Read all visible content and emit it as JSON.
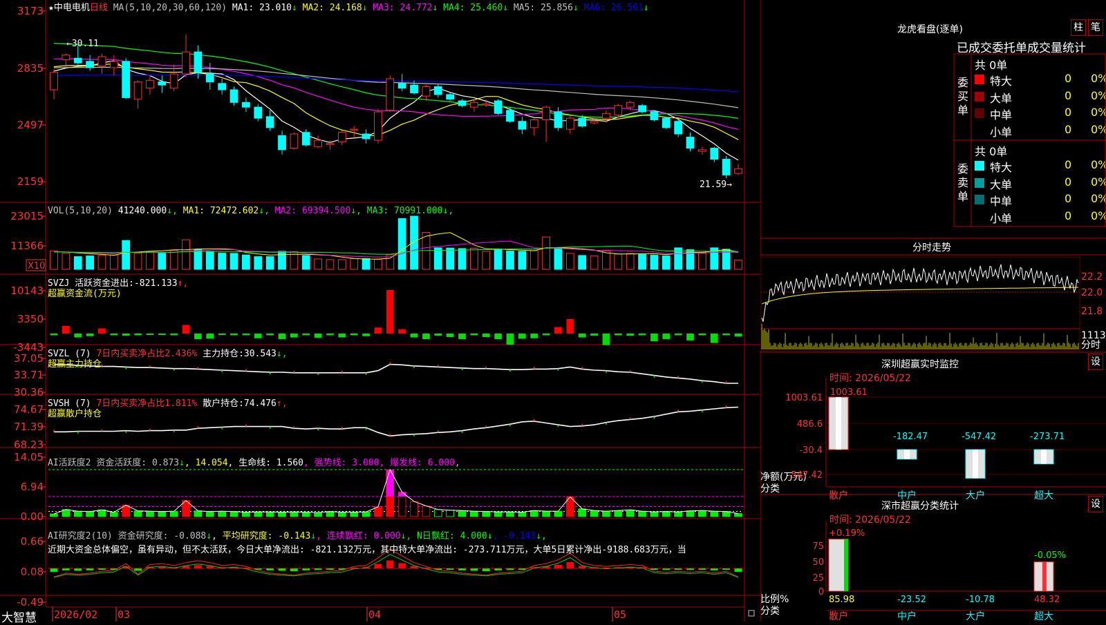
{
  "stock": {
    "name": "中电电机",
    "period": "日线",
    "star": "★"
  },
  "price_panel": {
    "ma_label": "MA(5,10,20,30,60,120)",
    "ma": [
      {
        "label": "MA1:",
        "value": "23.010",
        "arrow": "↓",
        "color": "#ffffff"
      },
      {
        "label": "MA2:",
        "value": "24.168",
        "arrow": "↓",
        "color": "#ffff00"
      },
      {
        "label": "MA3:",
        "value": "24.772",
        "arrow": "↓",
        "color": "#ff00ff"
      },
      {
        "label": "MA4:",
        "value": "25.460",
        "arrow": "↓",
        "color": "#00ff00"
      },
      {
        "label": "MA5:",
        "value": "25.856",
        "arrow": "↓",
        "color": "#c0c0c0"
      },
      {
        "label": "MA6:",
        "value": "26.561",
        "arrow": "↓",
        "color": "#0000ff"
      }
    ],
    "yticks": [
      "3173",
      "2835",
      "2497",
      "2159"
    ],
    "high_label": "30.11",
    "low_label": "21.59"
  },
  "vol_panel": {
    "label": "VOL(5,10,20)",
    "value": "41240.000",
    "ma": [
      {
        "label": "MA1:",
        "value": "72472.602",
        "color": "#ffff00"
      },
      {
        "label": "MA2:",
        "value": "69394.500",
        "color": "#ff00ff"
      },
      {
        "label": "MA3:",
        "value": "70991.000",
        "color": "#00ff00"
      }
    ],
    "yticks": [
      "23015",
      "11366"
    ],
    "unit": "X10"
  },
  "svzj_panel": {
    "label": "SVZJ  活跃资金进出:",
    "value": "-821.133",
    "arrow": "↑,",
    "sub": "超赢资金流(万元)",
    "yticks": [
      "10143",
      "3350",
      "-3443"
    ]
  },
  "svzl_panel": {
    "label": "SVZL (7)",
    "pct": "7日内买卖净占比2.436%",
    "hold_label": "主力持仓:",
    "hold": "30.543",
    "arrow": "↓,",
    "sub": "超赢主力持仓",
    "yticks": [
      "37.05",
      "33.71",
      "30.36"
    ]
  },
  "svsh_panel": {
    "label": "SVSH (7)",
    "pct": "7日内买卖净占比1.811%",
    "hold_label": "散户持仓:",
    "hold": "74.476",
    "arrow": "↑,",
    "sub": "超赢散户持仓",
    "yticks": [
      "74.67",
      "71.39",
      "68.23"
    ]
  },
  "ai1_panel": {
    "text_parts": [
      {
        "t": "AI活跃度2 资金活跃度: 0.873",
        "c": "#c0c0c0"
      },
      {
        "t": "↓",
        "c": "#00ff00"
      },
      {
        "t": ", 14.054",
        "c": "#ffff00"
      },
      {
        "t": ", 生命线: 1.560",
        "c": "#ffffff"
      },
      {
        "t": ", 强势线: 3.000",
        "c": "#ff00ff"
      },
      {
        "t": ", 爆发线: 6.000",
        "c": "#ff00ff"
      },
      {
        "t": ",",
        "c": "#c0c0c0"
      }
    ],
    "yticks": [
      "14.05",
      "6.94",
      "0.00"
    ]
  },
  "ai2_panel": {
    "text_parts": [
      {
        "t": "AI研究度2(10) 资金研究度: -0.088",
        "c": "#c0c0c0"
      },
      {
        "t": "↓",
        "c": "#00ff00"
      },
      {
        "t": ", 平均研究度: -0.143",
        "c": "#ffff00"
      },
      {
        "t": "↓",
        "c": "#00ff00"
      },
      {
        "t": ", 连续飘红: 0.000",
        "c": "#ff00ff"
      },
      {
        "t": "↓",
        "c": "#00ff00"
      },
      {
        "t": ", N日飘红: 4.000",
        "c": "#00ff00"
      },
      {
        "t": "↓",
        "c": "#00ff00"
      },
      {
        "t": ", -0.143",
        "c": "#0000ff"
      },
      {
        "t": "↓,",
        "c": "#00ff00"
      }
    ],
    "comment": "近期大资金总体偏空，虽有异动，但不太活跃，今日大单净流出: -821.132万元，其中特大单净流出: -273.711万元，大单5日累计净出-9188.683万元，当",
    "yticks": [
      "0.66",
      "0.08",
      "-0.49"
    ]
  },
  "x_axis": {
    "labels": [
      "2026/02",
      "03",
      "04",
      "05"
    ],
    "brand": "大智慧"
  },
  "chart_data": [
    {
      "type": "candlestick",
      "title": "中电电机 日线",
      "ylabel": "",
      "ylim": [
        21.0,
        31.8
      ],
      "ohlc": [
        [
          26.6,
          27.9,
          26.0,
          27.7
        ],
        [
          28.5,
          28.9,
          28.0,
          28.8
        ],
        [
          28.6,
          29.4,
          28.2,
          28.3
        ],
        [
          28.4,
          28.8,
          27.8,
          28.0
        ],
        [
          28.1,
          28.9,
          27.6,
          28.7
        ],
        [
          28.0,
          28.8,
          27.5,
          28.4
        ],
        [
          28.4,
          28.6,
          26.0,
          26.1
        ],
        [
          26.0,
          27.2,
          25.4,
          27.1
        ],
        [
          26.7,
          27.5,
          26.3,
          27.2
        ],
        [
          27.1,
          27.5,
          26.4,
          26.9
        ],
        [
          26.7,
          28.2,
          26.5,
          27.6
        ],
        [
          27.6,
          30.1,
          27.4,
          29.0
        ],
        [
          29.0,
          29.4,
          27.3,
          27.7
        ],
        [
          27.6,
          28.3,
          26.6,
          27.1
        ],
        [
          27.0,
          27.3,
          26.3,
          26.6
        ],
        [
          26.6,
          26.8,
          25.6,
          25.8
        ],
        [
          25.8,
          26.1,
          25.2,
          25.5
        ],
        [
          25.5,
          25.7,
          24.6,
          24.8
        ],
        [
          24.9,
          25.3,
          24.0,
          24.2
        ],
        [
          23.7,
          24.0,
          22.5,
          22.8
        ],
        [
          22.9,
          23.9,
          22.8,
          23.8
        ],
        [
          23.9,
          24.1,
          23.0,
          23.1
        ],
        [
          23.0,
          23.7,
          22.9,
          23.4
        ],
        [
          23.2,
          23.4,
          22.8,
          23.2
        ],
        [
          23.3,
          24.0,
          23.1,
          23.9
        ],
        [
          24.1,
          24.3,
          23.6,
          24.1
        ],
        [
          23.8,
          24.1,
          23.2,
          23.5
        ],
        [
          23.4,
          25.4,
          23.2,
          25.2
        ],
        [
          25.3,
          27.5,
          25.2,
          27.3
        ],
        [
          27.0,
          27.6,
          26.5,
          26.7
        ],
        [
          26.9,
          27.2,
          26.3,
          26.4
        ],
        [
          26.2,
          26.9,
          25.9,
          26.8
        ],
        [
          26.8,
          27.0,
          26.1,
          26.3
        ],
        [
          26.3,
          26.4,
          25.9,
          26.0
        ],
        [
          25.9,
          26.0,
          25.5,
          25.6
        ],
        [
          25.5,
          26.0,
          25.2,
          25.8
        ],
        [
          25.7,
          26.0,
          25.5,
          25.7
        ],
        [
          25.9,
          26.0,
          25.0,
          25.1
        ],
        [
          25.3,
          25.5,
          24.5,
          24.6
        ],
        [
          24.6,
          24.9,
          23.8,
          24.1
        ],
        [
          24.2,
          24.8,
          23.7,
          24.7
        ],
        [
          24.7,
          25.6,
          23.3,
          25.5
        ],
        [
          25.2,
          25.5,
          24.0,
          24.2
        ],
        [
          24.1,
          25.0,
          23.8,
          24.8
        ],
        [
          24.8,
          25.0,
          24.2,
          24.3
        ],
        [
          24.5,
          24.8,
          24.4,
          24.6
        ],
        [
          24.8,
          25.3,
          24.5,
          25.1
        ],
        [
          25.0,
          25.7,
          24.8,
          25.6
        ],
        [
          25.5,
          25.9,
          25.3,
          25.8
        ],
        [
          25.6,
          25.7,
          25.1,
          25.2
        ],
        [
          25.2,
          25.3,
          24.6,
          24.7
        ],
        [
          24.8,
          24.9,
          24.1,
          24.2
        ],
        [
          24.6,
          24.8,
          23.6,
          23.8
        ],
        [
          23.6,
          23.9,
          22.7,
          22.9
        ],
        [
          22.7,
          23.0,
          22.5,
          22.8
        ],
        [
          22.9,
          23.0,
          22.0,
          22.2
        ],
        [
          22.2,
          22.4,
          21.0,
          21.2
        ],
        [
          21.3,
          21.9,
          21.2,
          21.6
        ]
      ]
    },
    {
      "type": "bar",
      "title": "VOL(5,10,20)",
      "ylabel": "X10",
      "ylim": [
        0,
        23015
      ],
      "values": [
        8000,
        7000,
        5500,
        5800,
        6000,
        6200,
        12500,
        7000,
        7500,
        7000,
        8200,
        12800,
        8600,
        7800,
        7000,
        6900,
        6200,
        5500,
        5500,
        7800,
        7700,
        6000,
        4500,
        4200,
        4200,
        4600,
        4700,
        4300,
        6300,
        22000,
        23015,
        16000,
        9300,
        9200,
        9000,
        9100,
        7800,
        8800,
        7900,
        7800,
        8100,
        14000,
        9200,
        6900,
        6000,
        5800,
        8000,
        6600,
        6900,
        6400,
        6100,
        5800,
        9300,
        8500,
        6900,
        9300,
        8700,
        4000
      ]
    },
    {
      "type": "bar",
      "title": "SVZJ",
      "ylabel": "万元",
      "ylim": [
        -3443,
        10143
      ],
      "values": [
        -400,
        1800,
        -900,
        -600,
        1200,
        -400,
        -500,
        -400,
        -300,
        -300,
        -400,
        2000,
        -1300,
        -1200,
        -200,
        -400,
        -400,
        -1100,
        -400,
        -1300,
        -900,
        -400,
        -1000,
        -400,
        -900,
        -400,
        -600,
        1400,
        10143,
        1000,
        -900,
        -1300,
        -500,
        -800,
        -1300,
        -400,
        -800,
        -1300,
        -2600,
        -1200,
        -1100,
        -400,
        1500,
        3400,
        -900,
        -500,
        -2700,
        -400,
        -500,
        -400,
        -1800,
        -1300,
        -400,
        -1600,
        -400,
        -2200,
        -400,
        -700
      ]
    },
    {
      "type": "line",
      "title": "SVZL",
      "ylabel": "",
      "ylim": [
        30.36,
        37.05
      ],
      "values": [
        35.4,
        35.3,
        35.2,
        35.1,
        35.0,
        35.0,
        34.9,
        34.8,
        34.8,
        34.7,
        34.6,
        34.6,
        34.5,
        34.4,
        34.3,
        34.2,
        34.1,
        34.0,
        33.9,
        33.9,
        33.8,
        33.8,
        33.8,
        33.8,
        33.8,
        33.8,
        33.8,
        34.2,
        35.4,
        35.3,
        35.1,
        35.0,
        34.9,
        34.8,
        34.7,
        34.6,
        34.6,
        34.5,
        34.4,
        34.4,
        34.5,
        34.5,
        34.6,
        34.9,
        34.5,
        34.3,
        34.2,
        34.0,
        33.9,
        33.6,
        33.3,
        33.0,
        32.8,
        32.6,
        32.3,
        32.1,
        31.8,
        31.8
      ]
    },
    {
      "type": "line",
      "title": "SVSH",
      "ylabel": "",
      "ylim": [
        68.23,
        74.67
      ],
      "values": [
        70.3,
        70.3,
        70.4,
        70.4,
        70.4,
        70.4,
        70.5,
        70.4,
        70.5,
        70.5,
        70.6,
        70.6,
        70.9,
        71.0,
        71.1,
        71.2,
        71.2,
        71.2,
        71.2,
        71.2,
        70.9,
        70.8,
        70.9,
        70.8,
        70.8,
        71.0,
        71.0,
        70.2,
        69.6,
        69.8,
        69.9,
        70.0,
        70.2,
        70.3,
        70.5,
        70.8,
        71.0,
        71.3,
        71.6,
        72.0,
        72.1,
        71.8,
        71.5,
        71.2,
        71.3,
        71.5,
        71.9,
        72.2,
        72.4,
        72.6,
        72.9,
        73.3,
        73.7,
        73.8,
        74.0,
        74.2,
        74.4,
        74.5
      ]
    },
    {
      "type": "bar",
      "title": "AI活跃度2",
      "ylabel": "",
      "ylim": [
        0,
        14.05
      ],
      "values": [
        0.8,
        2.1,
        1.6,
        1.5,
        2.0,
        1.3,
        3.4,
        1.7,
        1.6,
        1.5,
        1.6,
        4.8,
        1.7,
        1.5,
        1.6,
        1.5,
        1.3,
        1.4,
        1.4,
        1.3,
        1.4,
        1.3,
        1.2,
        1.5,
        1.3,
        1.3,
        1.4,
        2.9,
        14.0,
        7.3,
        4.5,
        3.2,
        2.1,
        1.9,
        1.8,
        1.6,
        1.5,
        1.4,
        1.4,
        1.3,
        1.8,
        1.6,
        1.6,
        5.9,
        2.3,
        1.8,
        1.6,
        1.8,
        2.0,
        1.6,
        1.4,
        1.5,
        1.4,
        1.7,
        1.8,
        1.6,
        1.5,
        0.9
      ]
    },
    {
      "type": "bar",
      "title": "AI研究度2(10)",
      "ylabel": "",
      "ylim": [
        -0.49,
        0.66
      ],
      "values": [
        -0.09,
        -0.05,
        -0.06,
        -0.05,
        -0.03,
        -0.02,
        0.05,
        -0.06,
        0.04,
        0.05,
        0.03,
        0.06,
        0.08,
        0.06,
        0.03,
        0.04,
        0.02,
        -0.02,
        -0.05,
        -0.06,
        -0.07,
        -0.05,
        -0.04,
        -0.03,
        -0.02,
        0.02,
        0.03,
        0.11,
        0.2,
        0.13,
        0.06,
        0.02,
        -0.02,
        -0.03,
        -0.05,
        -0.06,
        -0.07,
        -0.05,
        -0.04,
        -0.03,
        0.03,
        0.05,
        0.09,
        0.16,
        0.06,
        0.03,
        0.02,
        0.03,
        0.04,
        0.03,
        -0.03,
        -0.04,
        -0.03,
        -0.04,
        -0.03,
        -0.05,
        -0.03,
        -0.09
      ]
    }
  ],
  "right_panel": {
    "dragon_title": "龙虎看盘(逐单)",
    "btn_zhu": "柱",
    "btn_bi": "笔",
    "stats_title": "已成交委托单成交量统计",
    "buy_label": "委买单",
    "sell_label": "委卖单",
    "buy_total": "共 0单",
    "sell_total": "共 0单",
    "buy_rows": [
      {
        "name": "特大",
        "count": "0",
        "pct": "0%",
        "color": "#ff0000"
      },
      {
        "name": "大单",
        "count": "0",
        "pct": "0%",
        "color": "#a00000"
      },
      {
        "name": "中单",
        "count": "0",
        "pct": "0%",
        "color": "#600000"
      },
      {
        "name": "小单",
        "count": "0",
        "pct": "0%",
        "color": "#000000"
      }
    ],
    "sell_rows": [
      {
        "name": "特大",
        "count": "0",
        "pct": "0%",
        "color": "#00ffff"
      },
      {
        "name": "大单",
        "count": "0",
        "pct": "0%",
        "color": "#00a0a0"
      },
      {
        "name": "中单",
        "count": "0",
        "pct": "0%",
        "color": "#007070"
      },
      {
        "name": "小单",
        "count": "0",
        "pct": "0%",
        "color": "#000000"
      }
    ],
    "intraday_title": "分时走势",
    "intraday_yticks": [
      "22.2",
      "22.0",
      "21.8",
      "1113"
    ],
    "intraday_vol_unit": "分时",
    "monitor_title": "深圳超赢实时监控",
    "monitor_time": "时间: 2026/05/22",
    "monitor_yticks": [
      "1003.61",
      "486.6",
      "-30.4",
      "-547.42"
    ],
    "monitor_ylabel": "净额(万元)",
    "monitor_xlabel": "分类",
    "monitor_chart": {
      "type": "bar",
      "categories": [
        "散户",
        "中户",
        "大户",
        "超大"
      ],
      "values": [
        1003.61,
        -182.47,
        -547.42,
        -273.71
      ],
      "labels": [
        "1003.61",
        "-182.47",
        "-547.42",
        "-273.71"
      ]
    },
    "class_title": "深市超赢分类统计",
    "class_time": "时间: 2026/05/22",
    "class_yticks": [
      "75",
      "50",
      "25",
      "0"
    ],
    "class_ylabel": "比例%",
    "class_xlabel": "分类",
    "class_chart": {
      "type": "bar",
      "categories": [
        "散户",
        "中户",
        "大户",
        "超大"
      ],
      "values": [
        85.98,
        -23.52,
        -10.78,
        48.32
      ],
      "top_labels": [
        "+0.19%",
        "",
        "",
        "-0.05%"
      ]
    },
    "set_btn": "设"
  }
}
